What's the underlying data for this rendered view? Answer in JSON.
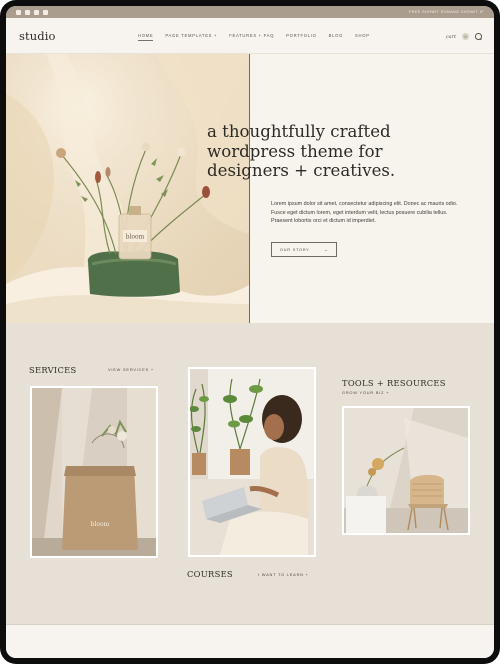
{
  "topbar": {
    "social_icons": [
      "facebook-icon",
      "instagram-icon",
      "youtube-icon",
      "pinterest-icon"
    ],
    "promo_text": "FREE SHOWIT ROBANG SHOWIT IF"
  },
  "header": {
    "logo": "studio",
    "nav": [
      "HOME",
      "PAGE TEMPLATES +",
      "FEATURES + FAQ",
      "PORTFOLIO",
      "BLOG",
      "SHOP"
    ],
    "active_nav": "HOME",
    "cart_label": "cart",
    "cart_count": "0"
  },
  "hero": {
    "title_lines": [
      "a thoughtfully crafted",
      "wordpress theme for",
      "designers + creatives."
    ],
    "body": "Lorem ipsum dolor sit amet, consectetur adipiscing elit. Donec ac mauris odio. Fusce eget dictum lorem, eget interdum velit, lectus posuere cubilia tellus. Praesent lobortis orci et dictum id imperdiet.",
    "button_label": "OUR STORY",
    "button_arrow": "→",
    "bottle_label": "bloom"
  },
  "sections": {
    "services": {
      "title": "SERVICES",
      "link": "VIEW SERVICES +"
    },
    "tools": {
      "title": "TOOLS + RESOURCES",
      "link": "GROW YOUR BIZ +"
    },
    "courses": {
      "title": "COURSES",
      "link": "I WANT TO LEARN +"
    },
    "bag_label": "bloom"
  },
  "colors": {
    "topbar": "#aa9d8e",
    "page_bg": "#f6f3ee",
    "section_bg": "#e7e0d7",
    "text_dark": "#2d2a26"
  }
}
